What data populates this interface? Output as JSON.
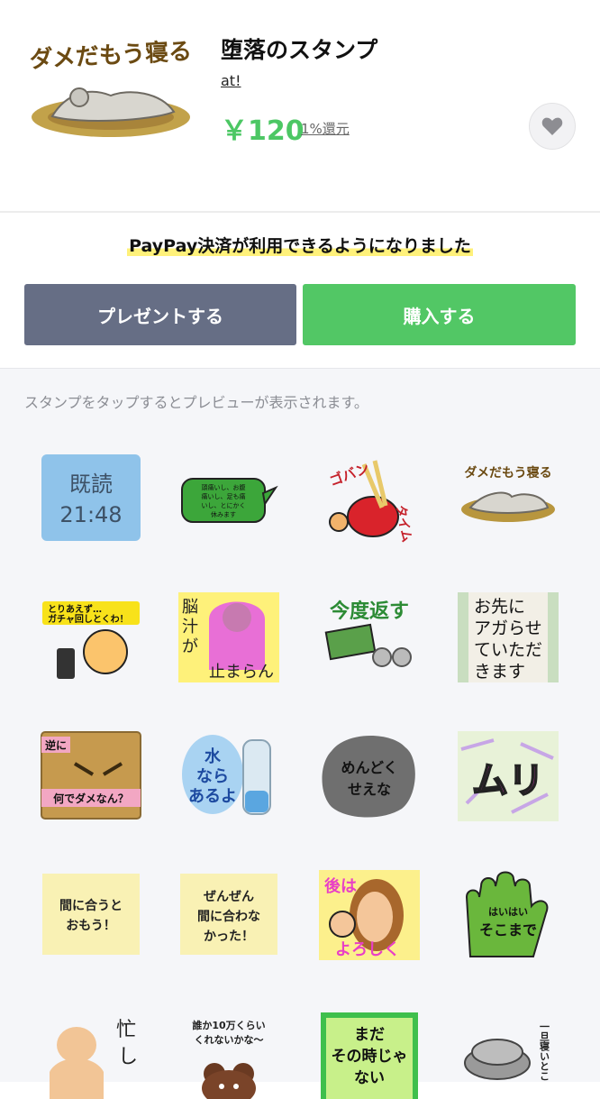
{
  "product": {
    "title": "堕落のスタンプ",
    "author": "at!",
    "price": "￥120",
    "rebate": "1%還元",
    "thumb_caption": "ダメだもう寝る"
  },
  "notice": "PayPay決済が利用できるようになりました",
  "buttons": {
    "present": "プレゼントする",
    "buy": "購入する"
  },
  "preview_hint": "スタンプをタップするとプレビューが表示されます。",
  "stickers": {
    "s1": [
      "既読",
      "21:48"
    ],
    "s2": [
      "頭痛いし、お腹",
      "痛いし、足も痛",
      "いし、とにかく",
      "休みます"
    ],
    "s3": [
      "ゴバン",
      "タイム"
    ],
    "s4": "ダメだもう寝る",
    "s5": [
      "とりあえず…",
      "ガチャ回しとくわ！"
    ],
    "s6": [
      "脳",
      "汁",
      "が",
      "止まらん"
    ],
    "s7": "今度返す",
    "s8": [
      "お先に",
      "アガらせ",
      "ていただ",
      "きます"
    ],
    "s9": [
      "逆に",
      "何でダメなん？"
    ],
    "s10": [
      "水",
      "なら",
      "あるよ"
    ],
    "s11": [
      "めんどく",
      "せえな"
    ],
    "s12": "ムリ",
    "s13": [
      "間に合うと",
      "おもう！"
    ],
    "s14": [
      "ぜんぜん",
      "間に合わな",
      "かった！"
    ],
    "s15": [
      "後は",
      "よろしく"
    ],
    "s16": [
      "はいはい",
      "そこまで"
    ],
    "s17": [
      "忙",
      "し"
    ],
    "s18": [
      "誰か10万くらい",
      "くれないかな〜"
    ],
    "s19": [
      "まだ",
      "その時じゃ",
      "ない"
    ],
    "s20": "一旦寝いとこ"
  }
}
